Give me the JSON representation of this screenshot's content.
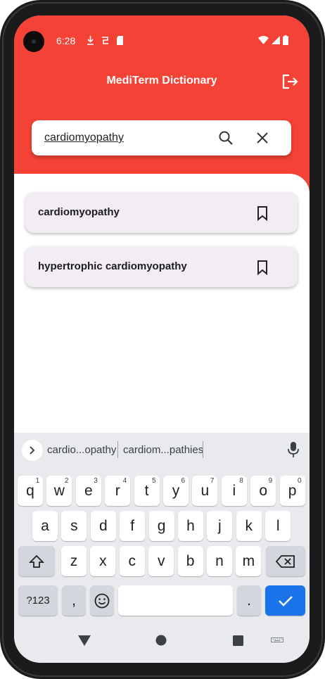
{
  "status_bar": {
    "time": "6:28"
  },
  "app": {
    "title": "MediTerm Dictionary"
  },
  "search": {
    "value": "cardiomyopathy"
  },
  "results": [
    {
      "label": "cardiomyopathy"
    },
    {
      "label": "hypertrophic cardiomyopathy"
    }
  ],
  "keyboard": {
    "suggestions": [
      "cardio...opathy",
      "cardiom...pathies"
    ],
    "row1": [
      {
        "key": "q",
        "num": "1"
      },
      {
        "key": "w",
        "num": "2"
      },
      {
        "key": "e",
        "num": "3"
      },
      {
        "key": "r",
        "num": "4"
      },
      {
        "key": "t",
        "num": "5"
      },
      {
        "key": "y",
        "num": "6"
      },
      {
        "key": "u",
        "num": "7"
      },
      {
        "key": "i",
        "num": "8"
      },
      {
        "key": "o",
        "num": "9"
      },
      {
        "key": "p",
        "num": "0"
      }
    ],
    "row2": [
      "a",
      "s",
      "d",
      "f",
      "g",
      "h",
      "j",
      "k",
      "l"
    ],
    "row3": [
      "z",
      "x",
      "c",
      "v",
      "b",
      "n",
      "m"
    ],
    "symbols_label": "?123",
    "comma": ",",
    "period": "."
  },
  "colors": {
    "header": "#f44336",
    "card": "#f1edf3",
    "enter_key": "#1a73e8"
  }
}
